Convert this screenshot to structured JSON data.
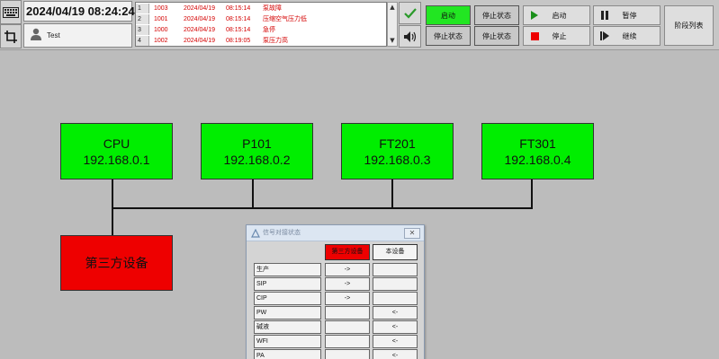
{
  "header": {
    "datetime": "2024/04/19 08:24:24",
    "user": "Test"
  },
  "alarms": [
    {
      "index": "1",
      "code": "1003",
      "date": "2024/04/19",
      "time": "08:15:14",
      "message": "泵故障"
    },
    {
      "index": "2",
      "code": "1001",
      "date": "2024/04/19",
      "time": "08:15:14",
      "message": "压缩空气压力低"
    },
    {
      "index": "3",
      "code": "1000",
      "date": "2024/04/19",
      "time": "08:15:14",
      "message": "急停"
    },
    {
      "index": "4",
      "code": "1002",
      "date": "2024/04/19",
      "time": "08:19:05",
      "message": "泵压力高"
    }
  ],
  "controls": {
    "start_status": "启动",
    "stop_status_1": "停止状态",
    "stop_status_2": "停止状态",
    "stop_status_3": "停止状态",
    "start_button": "启动",
    "stop_button": "停止",
    "pause_button": "暂停",
    "resume_button": "继续",
    "sequence_list_button": "阶段列表"
  },
  "network": {
    "nodes": [
      {
        "name": "CPU",
        "ip": "192.168.0.1"
      },
      {
        "name": "P101",
        "ip": "192.168.0.2"
      },
      {
        "name": "FT201",
        "ip": "192.168.0.3"
      },
      {
        "name": "FT301",
        "ip": "192.168.0.4"
      }
    ],
    "third_party": "第三方设备"
  },
  "signal_dialog": {
    "title": "信号对接状态",
    "columns": [
      "第三方设备",
      "本设备"
    ],
    "rows": [
      {
        "name": "生产",
        "third": "->",
        "local": ""
      },
      {
        "name": "SIP",
        "third": "->",
        "local": ""
      },
      {
        "name": "CIP",
        "third": "->",
        "local": ""
      },
      {
        "name": "PW",
        "third": "",
        "local": "<-"
      },
      {
        "name": "碱液",
        "third": "",
        "local": "<-"
      },
      {
        "name": "WFI",
        "third": "",
        "local": "<-"
      },
      {
        "name": "PA",
        "third": "",
        "local": "<-"
      }
    ]
  },
  "colors": {
    "node_green": "#00ee00",
    "third_party_red": "#ee0000",
    "alarm_text": "#d40000",
    "active_green": "#22e622"
  }
}
